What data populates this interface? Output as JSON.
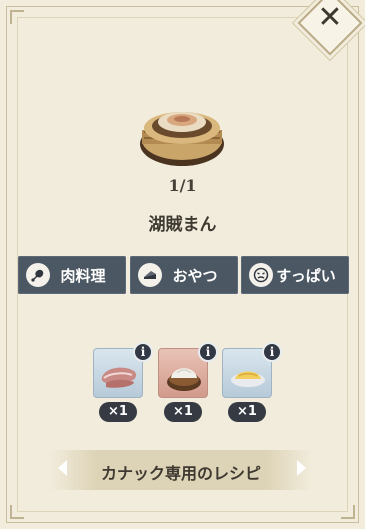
{
  "dish": {
    "count": "1/1",
    "name": "湖賊まん",
    "icon": "steamed-bun-in-basket-icon"
  },
  "tags": [
    {
      "label": "肉料理",
      "icon": "meat-icon"
    },
    {
      "label": "おやつ",
      "icon": "cake-icon"
    },
    {
      "label": "すっぱい",
      "icon": "sour-face-icon"
    }
  ],
  "ingredients": [
    {
      "icon": "ham-icon",
      "quantity": "×1",
      "info": "i",
      "rarity_color": "#b7cad8"
    },
    {
      "icon": "flour-bowl-icon",
      "quantity": "×1",
      "info": "i",
      "rarity_color": "#d19a8b"
    },
    {
      "icon": "omelette-icon",
      "quantity": "×1",
      "info": "i",
      "rarity_color": "#b7cad8"
    }
  ],
  "recipe_selector": {
    "label": "カナック専用のレシピ"
  },
  "close": {
    "icon": "close-icon",
    "glyph": "✕"
  },
  "colors": {
    "panel": "#f1ecdc",
    "tag_bg": "#4b5763",
    "accent_text": "#3f3a31"
  }
}
